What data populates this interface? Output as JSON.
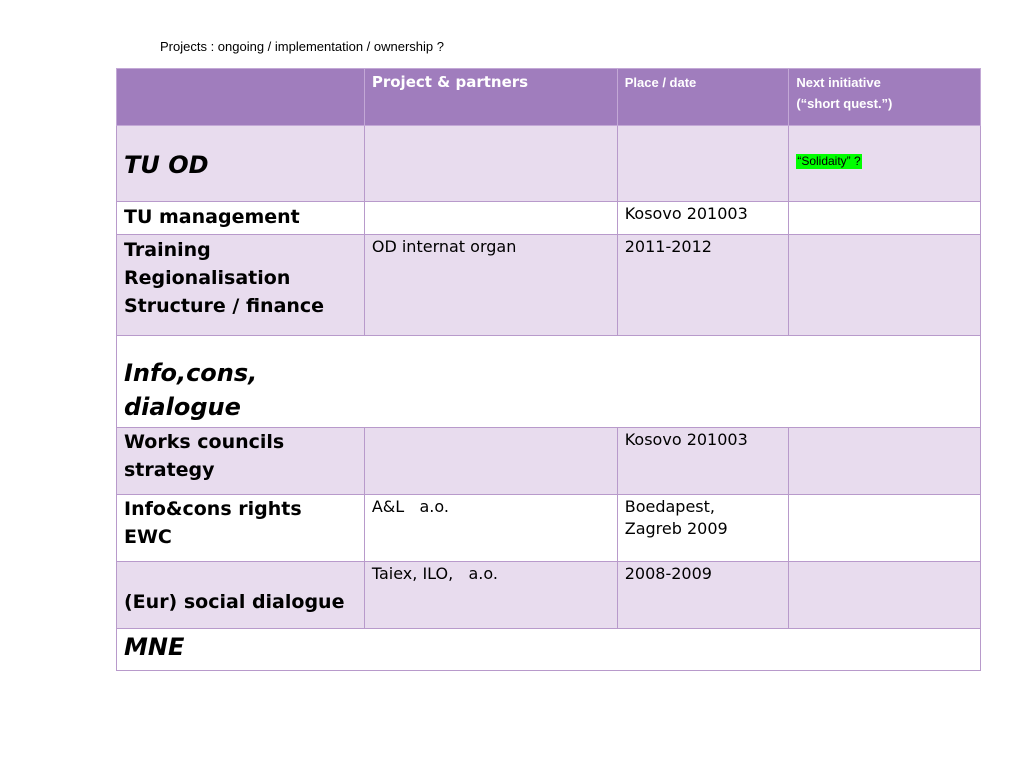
{
  "title": "Projects : ongoing / implementation / ownership ?",
  "header": {
    "col1": "",
    "col2": "Project & partners",
    "col3": "Place / date",
    "col4_line1": "Next initiative",
    "col4_line2": "(“short quest.”)"
  },
  "rows": [
    {
      "label": "TU OD",
      "partners": "",
      "place": "",
      "next": "“Solidaity” ?"
    },
    {
      "label": "TU management",
      "partners": "",
      "place": "Kosovo 201003",
      "next": ""
    },
    {
      "label_lines": [
        "Training",
        "Regionalisation",
        "Structure / finance"
      ],
      "partners": "OD internat organ",
      "place": "2011-2012",
      "next": ""
    },
    {
      "label_lines": [
        "Info,cons,",
        "dialogue"
      ],
      "partners": "",
      "place": "",
      "next": ""
    },
    {
      "label_lines": [
        "Works councils",
        "strategy"
      ],
      "partners": "",
      "place": "Kosovo 201003",
      "next": ""
    },
    {
      "label_lines": [
        "Info&cons rights",
        "EWC"
      ],
      "partners": "A&L   a.o.",
      "place_lines": [
        "Boedapest,",
        "Zagreb 2009"
      ],
      "next": ""
    },
    {
      "label": "(Eur) social dialogue",
      "partners": "Taiex, ILO,   a.o.",
      "place": "2008-2009",
      "next": ""
    },
    {
      "label": "MNE",
      "partners": "",
      "place": "",
      "next": ""
    }
  ],
  "colors": {
    "header_bg": "#a07dbd",
    "row_shade": "#e8dcee",
    "highlight": "#00ff00"
  }
}
